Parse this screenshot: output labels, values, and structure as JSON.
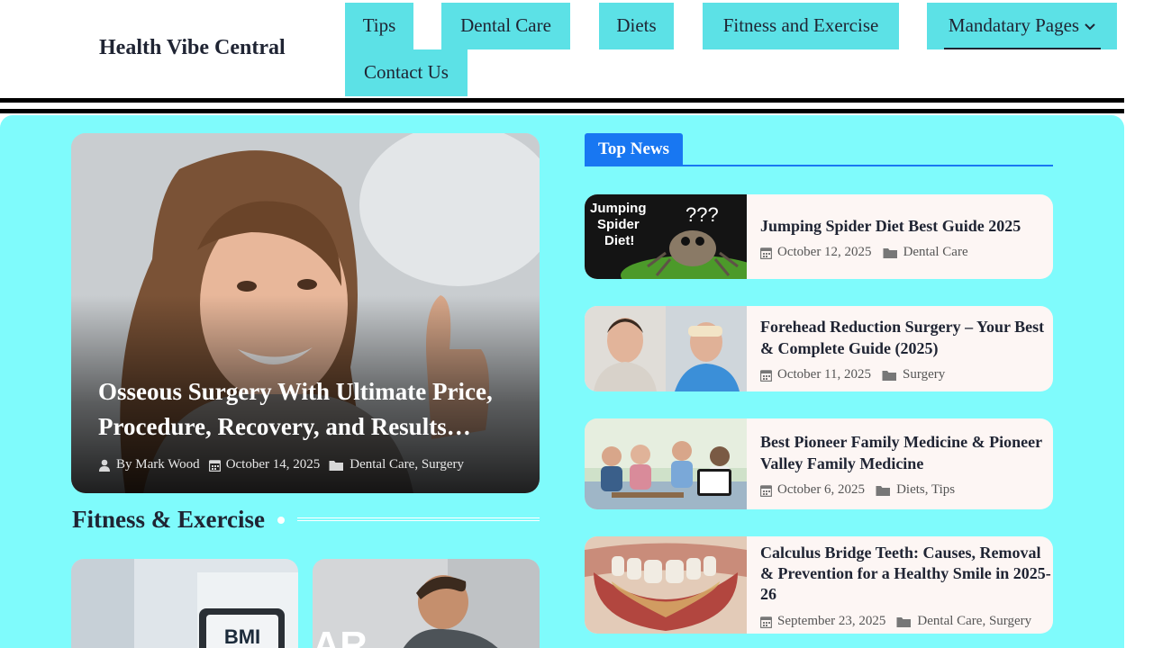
{
  "site": {
    "title": "Health Vibe Central"
  },
  "nav": {
    "items": [
      "Tips",
      "Dental Care",
      "Diets",
      "Fitness and Exercise",
      "Mandatary Pages",
      "Contact Us"
    ]
  },
  "hero": {
    "title": "Osseous Surgery With Ultimate Price, Procedure, Recovery, and Results…",
    "author": "By Mark Wood",
    "date": "October 14, 2025",
    "category1": "Dental Care",
    "category2": "Surgery",
    "sep": ","
  },
  "fitness": {
    "heading": "Fitness & Exercise",
    "card1_thumb_text": "BMI",
    "card2_thumb_text": "AR"
  },
  "top_news": {
    "label": "Top News",
    "items": [
      {
        "title": "Jumping Spider Diet Best Guide 2025",
        "date": "October 12, 2025",
        "cats": "Dental Care",
        "thumb_text": "Jumping Spider Diet!"
      },
      {
        "title": "Forehead Reduction Surgery – Your Best & Complete Guide (2025)",
        "date": "October 11, 2025",
        "cats": "Surgery"
      },
      {
        "title": "Best Pioneer Family Medicine & Pioneer Valley Family Medicine",
        "date": "October 6, 2025",
        "cats": "Diets, Tips"
      },
      {
        "title": "Calculus Bridge Teeth: Causes, Removal & Prevention for a Healthy Smile in 2025-26",
        "date": "September 23, 2025",
        "cats": "Dental Care, Surgery"
      }
    ]
  },
  "colors": {
    "nav_bg": "#5ce1e6",
    "panel_bg": "#7ffbfc",
    "badge_blue": "#1877f2",
    "card_bg": "#fdf6f4"
  },
  "icons": [
    "user-icon",
    "calendar-icon",
    "folder-icon",
    "chevron-down-icon"
  ]
}
